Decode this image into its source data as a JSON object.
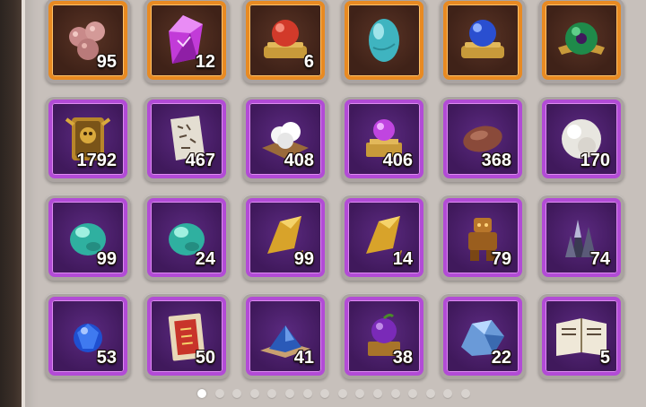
{
  "inventory": {
    "rows": [
      [
        {
          "icon": "rose-quartz-beads-icon",
          "rarity": "orange",
          "count": "95"
        },
        {
          "icon": "purple-crystal-icon",
          "rarity": "orange",
          "count": "12"
        },
        {
          "icon": "red-orb-on-stand-icon",
          "rarity": "orange",
          "count": "6"
        },
        {
          "icon": "teal-egg-icon",
          "rarity": "orange",
          "count": ""
        },
        {
          "icon": "blue-orb-on-stand-icon",
          "rarity": "orange",
          "count": ""
        },
        {
          "icon": "jade-disc-icon",
          "rarity": "orange",
          "count": ""
        }
      ],
      [
        {
          "icon": "golden-beast-tablet-icon",
          "rarity": "purple",
          "count": "1792"
        },
        {
          "icon": "scroll-fragment-icon",
          "rarity": "purple",
          "count": "467"
        },
        {
          "icon": "cotton-on-tray-icon",
          "rarity": "purple",
          "count": "408"
        },
        {
          "icon": "magic-orb-altar-icon",
          "rarity": "purple",
          "count": "406"
        },
        {
          "icon": "dried-meat-icon",
          "rarity": "purple",
          "count": "368"
        },
        {
          "icon": "pearl-icon",
          "rarity": "purple",
          "count": "170"
        }
      ],
      [
        {
          "icon": "teal-gem-icon",
          "rarity": "purple",
          "count": "99"
        },
        {
          "icon": "teal-gem-icon",
          "rarity": "purple",
          "count": "24"
        },
        {
          "icon": "gold-shard-icon",
          "rarity": "purple",
          "count": "99"
        },
        {
          "icon": "gold-shard-icon",
          "rarity": "purple",
          "count": "14"
        },
        {
          "icon": "bronze-golem-icon",
          "rarity": "purple",
          "count": "79"
        },
        {
          "icon": "dark-crystal-cluster-icon",
          "rarity": "purple",
          "count": "74"
        }
      ],
      [
        {
          "icon": "blue-sapphire-icon",
          "rarity": "purple",
          "count": "53"
        },
        {
          "icon": "red-envelope-icon",
          "rarity": "purple",
          "count": "50"
        },
        {
          "icon": "blue-sand-pile-icon",
          "rarity": "purple",
          "count": "41"
        },
        {
          "icon": "purple-fruit-chest-icon",
          "rarity": "purple",
          "count": "38"
        },
        {
          "icon": "blue-ore-icon",
          "rarity": "purple",
          "count": "22"
        },
        {
          "icon": "open-book-icon",
          "rarity": "purple",
          "count": "5"
        }
      ]
    ]
  },
  "pager": {
    "total_pages": 16,
    "current_page": 1
  },
  "colors": {
    "orange_frame": "#e88a22",
    "purple_frame": "#b24bd6"
  }
}
